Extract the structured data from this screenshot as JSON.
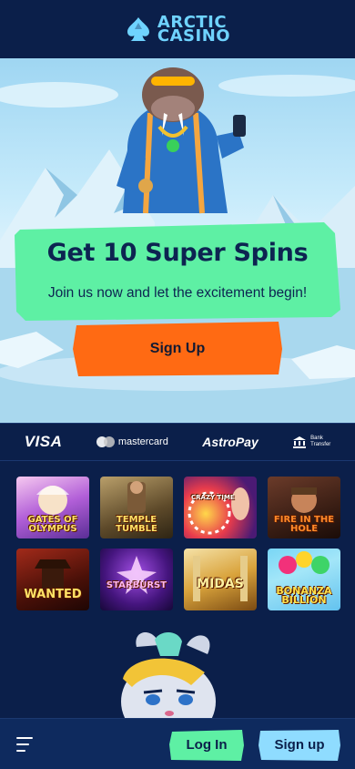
{
  "brand": {
    "line1": "ARCTIC",
    "line2": "CASINO",
    "color": "#6fd3ff",
    "icon": "spade-icon"
  },
  "hero": {
    "title": "Get 10 Super Spins",
    "subtitle": "Join us now and let the excitement begin!",
    "signup_label": "Sign Up",
    "card_color": "#5ef0a4",
    "button_color": "#ff6a13",
    "image": "walrus-mascot-illustration"
  },
  "payments": {
    "visa": "VISA",
    "mastercard": "mastercard",
    "astropay": "AstroPay",
    "bank_line1": "Bank",
    "bank_line2": "Transfer"
  },
  "games": [
    {
      "title": "GATES OF OLYMPUS"
    },
    {
      "title": "TEMPLE TUMBLE"
    },
    {
      "title": "CRAZY TIME"
    },
    {
      "title": "FIRE IN THE HOLE"
    },
    {
      "title": "WANTED"
    },
    {
      "title": "STARBURST"
    },
    {
      "title": "MIDAS"
    },
    {
      "title": "BONANZA BILLION"
    }
  ],
  "bottom_bar": {
    "login_label": "Log In",
    "signup_label": "Sign up",
    "login_color": "#5ef0a4",
    "signup_color": "#8fdcff",
    "menu_icon": "menu-icon"
  }
}
